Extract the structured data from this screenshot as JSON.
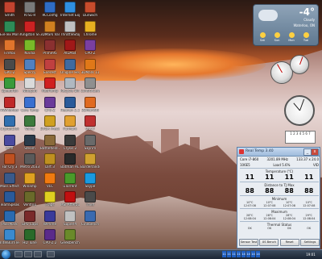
{
  "desktop": {
    "icons": [
      {
        "label": "Smith",
        "color": "#c2432f"
      },
      {
        "label": "RTSL-R",
        "color": "#7a7a7a"
      },
      {
        "label": "RCConfig",
        "color": "#2f6cc4"
      },
      {
        "label": "Internet Explorer",
        "color": "#2f8fe0"
      },
      {
        "label": "Dunwich",
        "color": "#c74c2c"
      },
      {
        "label": "EvFlex Monitor",
        "color": "#2e8b57"
      },
      {
        "label": "Kingston SSD Toolbox",
        "color": "#cc2222"
      },
      {
        "label": "3DMark Vantage",
        "color": "#d08020"
      },
      {
        "label": "ThrottleStop",
        "color": "#c0c0c0"
      },
      {
        "label": "Chrome",
        "color": "#e8b020"
      },
      {
        "label": "Firefox",
        "color": "#e0742c"
      },
      {
        "label": "Nvidia",
        "color": "#79b928"
      },
      {
        "label": "Prime95",
        "color": "#8a3030"
      },
      {
        "label": "AIDA64",
        "color": "#a01818"
      },
      {
        "label": "CPU-Z",
        "color": "#7a3fa0"
      },
      {
        "label": "GPU-Z",
        "color": "#4a4a4a"
      },
      {
        "label": "Speccy",
        "color": "#5080c0"
      },
      {
        "label": "Everest",
        "color": "#c04040"
      },
      {
        "label": "Unigine Heaven",
        "color": "#3f6aa0"
      },
      {
        "label": "3DMark 11",
        "color": "#e07818"
      },
      {
        "label": "SpeedFan",
        "color": "#3a9a3a"
      },
      {
        "label": "Notepad",
        "color": "#dadada"
      },
      {
        "label": "RealTemp",
        "color": "#d02020"
      },
      {
        "label": "Recycle Bin",
        "color": "#b0b8c0"
      },
      {
        "label": "ControlCenter",
        "color": "#8f8f8f"
      },
      {
        "label": "HWMonitor",
        "color": "#c02828"
      },
      {
        "label": "Core Temp",
        "color": "#3a6fd0"
      },
      {
        "label": "CPU-Z",
        "color": "#6a3a9a"
      },
      {
        "label": "Heaven 2.1",
        "color": "#2a5a9a"
      },
      {
        "label": "3DMark06",
        "color": "#e06a20"
      },
      {
        "label": "CrystalDisk",
        "color": "#3070b0"
      },
      {
        "label": "Valley",
        "color": "#3c7a3c"
      },
      {
        "label": "EVGA Precision",
        "color": "#d0a020"
      },
      {
        "label": "FurMark",
        "color": "#e0a030"
      },
      {
        "label": "OCCT",
        "color": "#c03030"
      },
      {
        "label": "LinX",
        "color": "#4a4aa0"
      },
      {
        "label": "Steam",
        "color": "#2a3a4a"
      },
      {
        "label": "Battlefield 3",
        "color": "#8a6a3a"
      },
      {
        "label": "Crysis 2",
        "color": "#3a3a3a"
      },
      {
        "label": "Skyrim",
        "color": "#6a6a6a"
      },
      {
        "label": "Far Cry 3",
        "color": "#c05020"
      },
      {
        "label": "Metro 2033",
        "color": "#5a5a5a"
      },
      {
        "label": "Dirt 3",
        "color": "#c09020"
      },
      {
        "label": "Batman AC",
        "color": "#2a2a2a"
      },
      {
        "label": "Borderlands 2",
        "color": "#d0a030"
      },
      {
        "label": "Mass Effect 3",
        "color": "#3a5a8a"
      },
      {
        "label": "Winamp",
        "color": "#e0a020"
      },
      {
        "label": "VLC",
        "color": "#f07a10"
      },
      {
        "label": "uTorrent",
        "color": "#4a9a2a"
      },
      {
        "label": "Skype",
        "color": "#1a9ae0"
      },
      {
        "label": "TeamSpeak",
        "color": "#2a5a9a"
      },
      {
        "label": "Ventrilo",
        "color": "#6a6a2a"
      },
      {
        "label": "Fraps",
        "color": "#e0d020"
      },
      {
        "label": "MSI Afterburner",
        "color": "#c01010"
      },
      {
        "label": "Thief",
        "color": "#4a4a4a"
      },
      {
        "label": "PassMark",
        "color": "#2a6ab0"
      },
      {
        "label": "GPU Caps",
        "color": "#7a2a2a"
      },
      {
        "label": "WPrime",
        "color": "#3a3a9a"
      },
      {
        "label": "SuperPI",
        "color": "#c0c0c0"
      },
      {
        "label": "Cinebench",
        "color": "#3a6ab0"
      },
      {
        "label": "IntelBurnTest",
        "color": "#3a8ad0"
      },
      {
        "label": "HD Tune",
        "color": "#2a6a2a"
      },
      {
        "label": "CPU-Z 2",
        "color": "#5a2a8a"
      },
      {
        "label": "Geekbench",
        "color": "#6a8a2a"
      }
    ]
  },
  "weather": {
    "temperature": "-4°",
    "condition": "Cloudy",
    "location": "Waterloo, ON",
    "days": [
      "Sat",
      "Sun",
      "Mon",
      "Tue"
    ]
  },
  "calendar": {
    "text": "1 2 3 4 5 6 7"
  },
  "realtemp": {
    "title": "Real Temp 3.40",
    "cpu": "Core i7-860",
    "freq": "3201.89 MHz",
    "vid": "133.37 x 24.0",
    "vid_label": "VID",
    "load_label": "Load",
    "load": "5.6%",
    "id_label": "106E5",
    "temps_header": "Temperature (°C)",
    "temps": [
      "11",
      "11",
      "11",
      "11"
    ],
    "dtj_header": "Distance to TJ Max",
    "dtj": [
      "88",
      "88",
      "88",
      "88"
    ],
    "min_header": "Minimum",
    "min_vals": [
      "10°C",
      "10°C",
      "10°C",
      "10°C"
    ],
    "min_times": [
      "12:07:08",
      "12:07:08",
      "12:07:08",
      "12:07:08"
    ],
    "max_header": "Maximum",
    "max_vals": [
      "28°C",
      "28°C",
      "28°C",
      "29°C"
    ],
    "max_times": [
      "12:08:04",
      "12:08:04",
      "12:08:04",
      "12:08:04"
    ],
    "thermal_header": "Thermal Status",
    "thermal": [
      "OK",
      "OK",
      "OK",
      "OK"
    ],
    "buttons": [
      "Sensor Test",
      "XS Bench",
      "Reset",
      "Settings"
    ]
  },
  "taskbar": {
    "clock": "19:01",
    "tray_nums": [
      "11",
      "11",
      "11",
      "11",
      "14",
      "14",
      "14",
      "14"
    ]
  }
}
